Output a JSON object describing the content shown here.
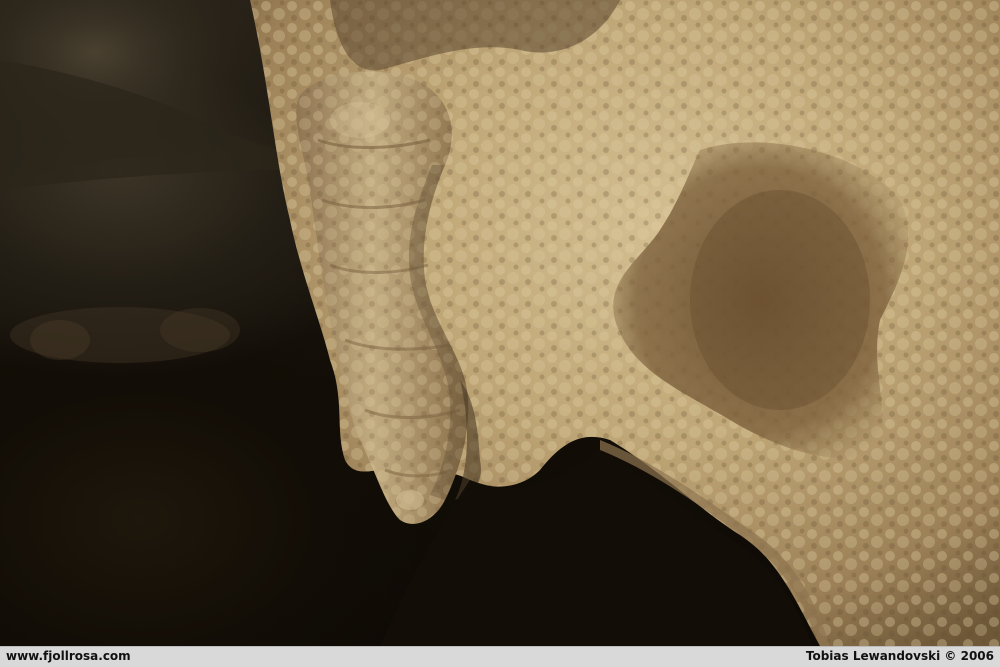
{
  "caption": {
    "website": "www.fjollrosa.com",
    "credit": "Tobias Lewandovski © 2006"
  },
  "colors": {
    "rock_light": "#c9b284",
    "rock_mid": "#a68a5c",
    "rock_dark": "#6e5838",
    "cave_shadow": "#120d07",
    "caption_bar": "#d9d9d9"
  }
}
